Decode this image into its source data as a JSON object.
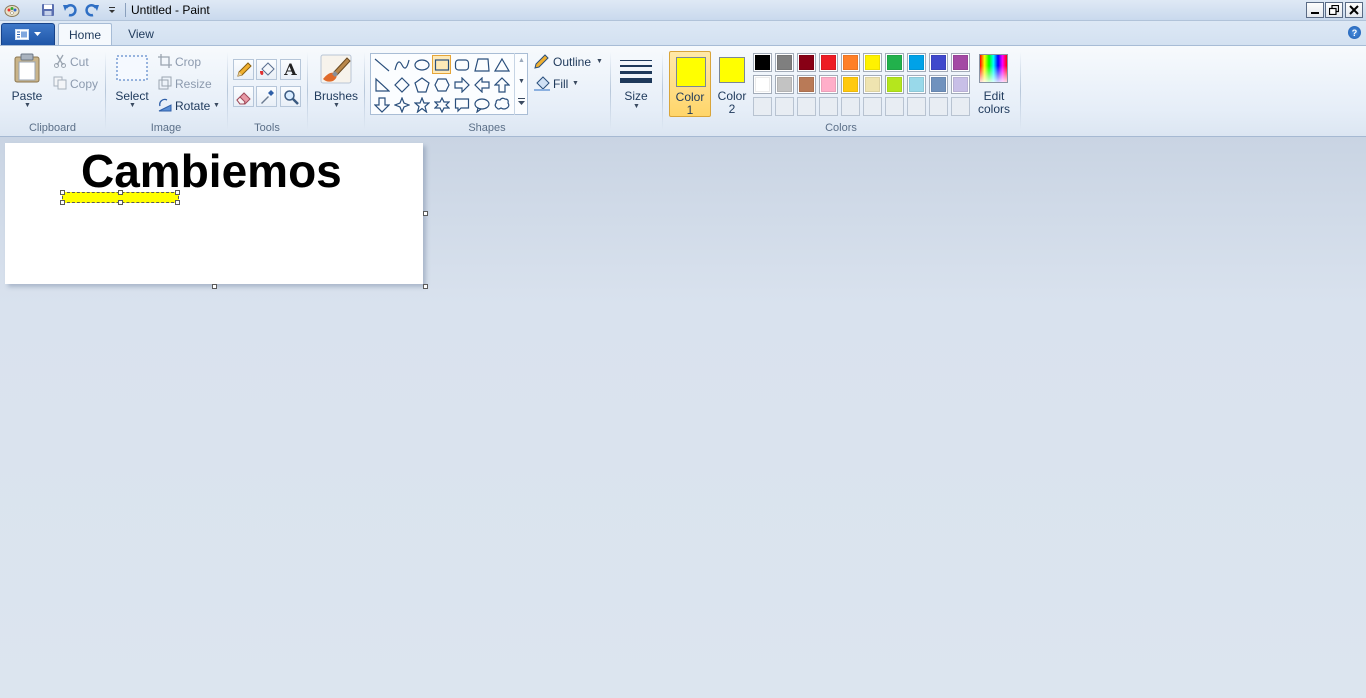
{
  "window": {
    "title": "Untitled - Paint",
    "controls": [
      "minimize",
      "restore",
      "close"
    ]
  },
  "tabs": [
    {
      "label": "Home",
      "active": true
    },
    {
      "label": "View",
      "active": false
    }
  ],
  "ribbon": {
    "clipboard": {
      "group_label": "Clipboard",
      "paste": "Paste",
      "cut": "Cut",
      "copy": "Copy"
    },
    "image": {
      "group_label": "Image",
      "select": "Select",
      "crop": "Crop",
      "resize": "Resize",
      "rotate": "Rotate"
    },
    "tools": {
      "group_label": "Tools",
      "items": [
        "pencil-icon",
        "fill-bucket-icon",
        "text-icon",
        "eraser-icon",
        "color-picker-icon",
        "magnifier-icon"
      ]
    },
    "brushes": {
      "label": "Brushes"
    },
    "shapes": {
      "group_label": "Shapes",
      "outline": "Outline",
      "fill": "Fill",
      "selected": "rectangle"
    },
    "size": {
      "label": "Size"
    },
    "colors": {
      "group_label": "Colors",
      "color1_line1": "Color",
      "color1_line2": "1",
      "color2_line1": "Color",
      "color2_line2": "2",
      "color1_value": "#ffff00",
      "color2_value": "#ffff00",
      "edit_line1": "Edit",
      "edit_line2": "colors",
      "palette_row1": [
        "#000000",
        "#7f7f7f",
        "#880015",
        "#ed1c24",
        "#ff7f27",
        "#fff200",
        "#22b14c",
        "#00a2e8",
        "#3f48cc",
        "#a349a4"
      ],
      "palette_row2": [
        "#ffffff",
        "#c3c3c3",
        "#b97a57",
        "#ffaec9",
        "#ffc90e",
        "#efe4b0",
        "#b5e61d",
        "#99d9ea",
        "#7092be",
        "#c8bfe7"
      ]
    }
  },
  "canvas": {
    "text": "Cambiemos",
    "selection_color": "#ffff00"
  }
}
